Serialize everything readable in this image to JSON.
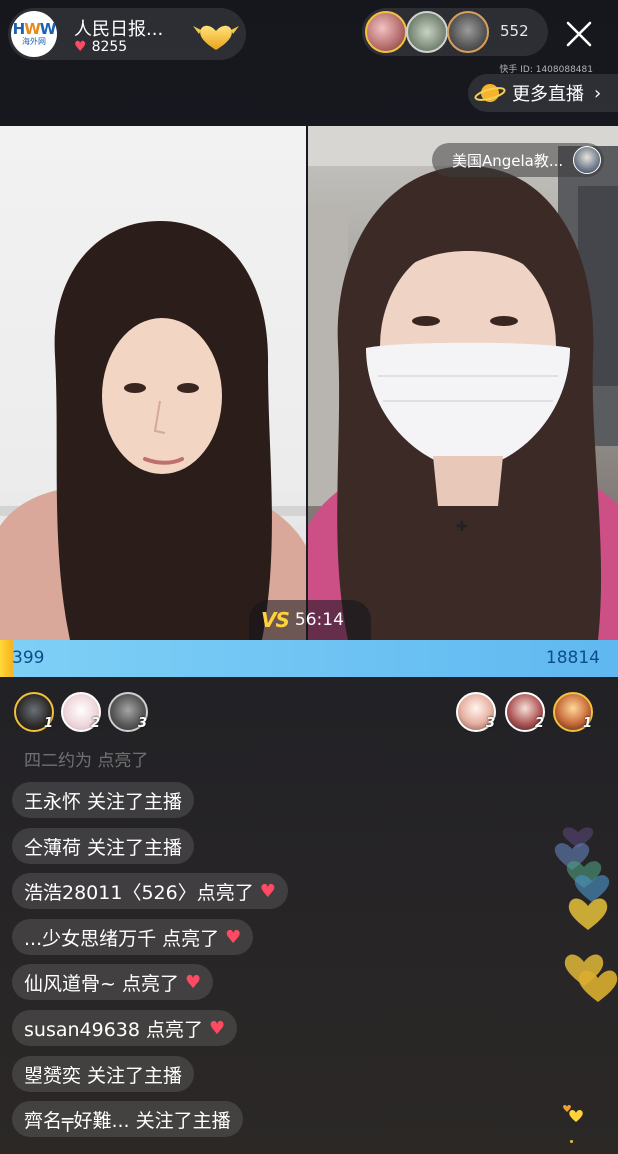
{
  "host": {
    "avatar_logo": "HWW",
    "avatar_sub": "海外网",
    "name": "人民日报...",
    "likes": "8255",
    "follow_icon": "gold-heart-icon"
  },
  "viewers": {
    "count": "552"
  },
  "kuaishou_id": "快手 ID: 1408088481",
  "more_live": {
    "label": "更多直播",
    "icon": "planet-icon"
  },
  "opponent_tag": {
    "name": "美国Angela教..."
  },
  "pk": {
    "timer": "56:14",
    "vs_label": "VS",
    "left_score": "399",
    "right_score": "18814",
    "left_share": 0.021
  },
  "rank": {
    "left": [
      "1",
      "2",
      "3"
    ],
    "right": [
      "3",
      "2",
      "1"
    ]
  },
  "comments": {
    "faded": "四二约为 点亮了",
    "items": [
      {
        "text": "王永怀 关注了主播",
        "heart": false
      },
      {
        "text": "仝薄荷 关注了主播",
        "heart": false
      },
      {
        "text": "浩浩28011〈526〉点亮了",
        "heart": true
      },
      {
        "text": "...少女思绪万千 点亮了",
        "heart": true
      },
      {
        "text": "仙风道骨~ 点亮了",
        "heart": true
      },
      {
        "text": "susan49638 点亮了",
        "heart": true
      },
      {
        "text": "曌赟奕 关注了主播",
        "heart": false
      },
      {
        "text": "齊名╤好難... 关注了主播",
        "heart": false
      }
    ]
  },
  "colors": {
    "pk_left": "#f7b21f",
    "pk_right": "#5fb8f0",
    "heart": "#ff4a64"
  }
}
